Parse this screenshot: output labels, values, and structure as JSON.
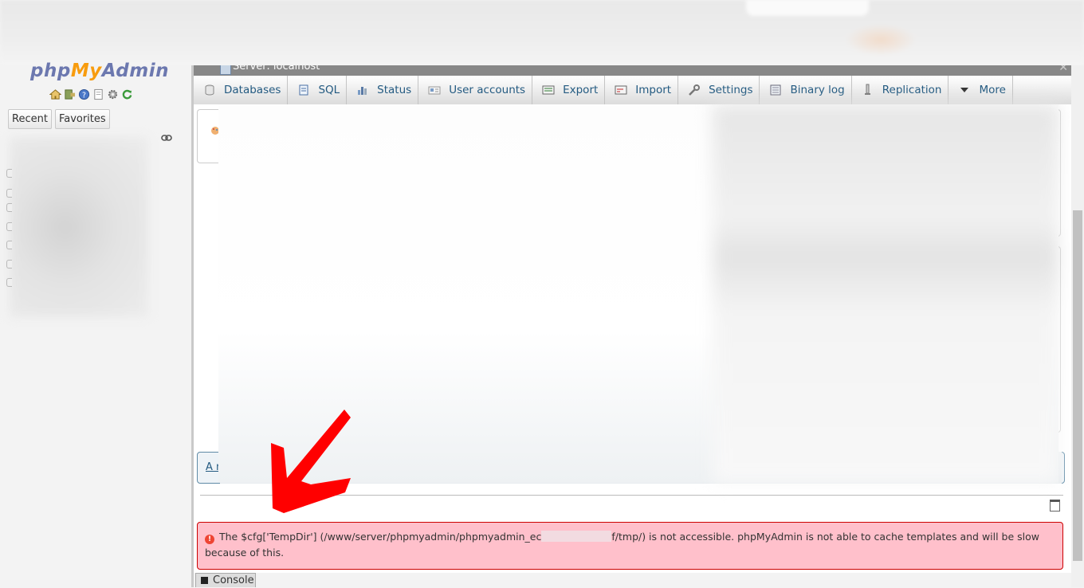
{
  "nav": {
    "logo_php": "php",
    "logo_my": "My",
    "logo_admin": "Admin",
    "icons": [
      "home-icon",
      "exit-icon",
      "help-icon",
      "docs-icon",
      "settings-icon",
      "reload-icon"
    ],
    "recent_label": "Recent",
    "favorites_label": "Favorites"
  },
  "server": {
    "breadcrumb": "Server: localhost"
  },
  "menu": {
    "tabs": [
      {
        "label": "Databases",
        "icon": "database-icon"
      },
      {
        "label": "SQL",
        "icon": "sql-icon"
      },
      {
        "label": "Status",
        "icon": "status-icon"
      },
      {
        "label": "User accounts",
        "icon": "users-icon"
      },
      {
        "label": "Export",
        "icon": "export-icon"
      },
      {
        "label": "Import",
        "icon": "import-icon"
      },
      {
        "label": "Settings",
        "icon": "wrench-icon"
      },
      {
        "label": "Binary log",
        "icon": "binlog-icon"
      },
      {
        "label": "Replication",
        "icon": "replication-icon"
      },
      {
        "label": "More",
        "icon": "caret-down-icon"
      }
    ]
  },
  "notice": {
    "link_text": "A n"
  },
  "error": {
    "text_before": "The $cfg['TempDir'] (/www/server/phpmyadmin/phpmyadmin_ec",
    "text_after": "f/tmp/) is not accessible. phpMyAdmin is not able to cache templates and will be slow because of this."
  },
  "console": {
    "label": "Console"
  },
  "colors": {
    "link": "#235a81",
    "error_bg": "#ffc0cb",
    "error_border": "#cc0000",
    "arrow": "#ff0000"
  }
}
